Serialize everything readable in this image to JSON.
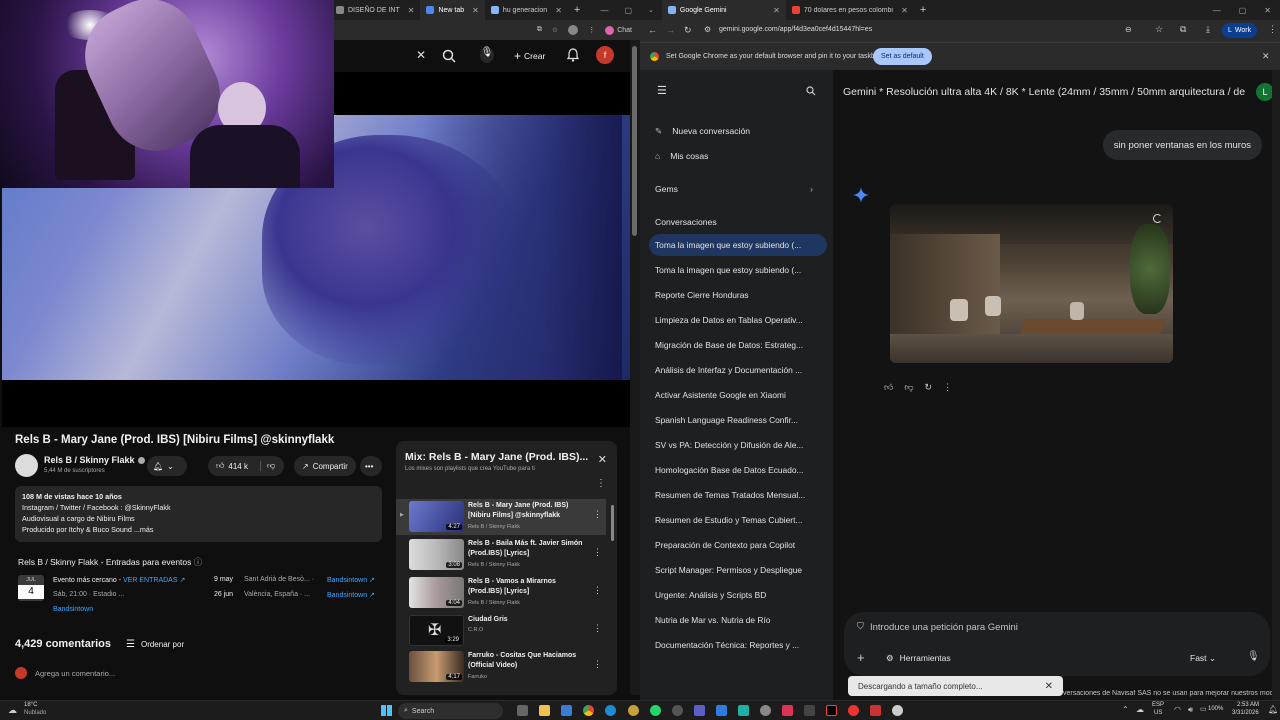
{
  "youtube": {
    "tabs": [
      {
        "label": "DISEÑO DE INT"
      },
      {
        "label": "New tab"
      },
      {
        "label": "hu generacion"
      }
    ],
    "header": {
      "create_label": "Crear",
      "avatar_letter": "f",
      "chat_label": "Chat"
    },
    "video_title": "Rels B - Mary Jane (Prod. IBS) [Nibiru Films] @skinnyflakk",
    "channel": {
      "name": "Rels B / Skinny Flakk",
      "subscribers": "5,44 M de suscriptores"
    },
    "likes": "414 k",
    "share_label": "Compartir",
    "description": {
      "meta": "108 M de vistas  hace 10 años",
      "lines": [
        "Instagram / Twitter / Facebook : @SkinnyFlakk",
        "Audiovisual a cargo de Nibiru Films",
        "Producido por Itchy & Buco Sound   ...más"
      ]
    },
    "events": {
      "title": "Rels B / Skinny Flakk - Entradas para eventos",
      "badge_month": "JUL",
      "badge_day": "4",
      "featured_title": "Evento más cercano -",
      "featured_link": "VER ENTRADAS",
      "featured_sub": "Sáb, 21:00 · Estadio ...",
      "featured_source": "Bandsintown",
      "list": [
        {
          "date": "9 may",
          "place": "Sant Adrià de Besò... ·",
          "source": "Bandsintown"
        },
        {
          "date": "26 jun",
          "place": "València, España · ...",
          "source": "Bandsintown"
        }
      ]
    },
    "comments_count": "4,429 comentarios",
    "sort_label": "Ordenar por",
    "add_comment_placeholder": "Agrega un comentario...",
    "mix": {
      "title": "Mix: Rels B - Mary Jane (Prod. IBS)...",
      "subtitle": "Los mixes son playlists que crea YouTube para ti",
      "items": [
        {
          "title": "Rels B - Mary Jane (Prod. IBS) [Nibiru Films] @skinnyflakk",
          "channel": "Rels B / Skinny Flakk",
          "duration": "4:27"
        },
        {
          "title": "Rels B - Baila Más ft. Javier Simón (Prod.IBS) [Lyrics]",
          "channel": "Rels B / Skinny Flakk",
          "duration": "3:08"
        },
        {
          "title": "Rels B - Vamos a Mirarnos (Prod.IBS) [Lyrics]",
          "channel": "Rels B / Skinny Flakk",
          "duration": "4:04"
        },
        {
          "title": "Ciudad Gris",
          "channel": "C.R.O",
          "duration": "3:29"
        },
        {
          "title": "Farruko - Cositas Que Haciamos (Official Video)",
          "channel": "Farruko",
          "duration": "4:17"
        }
      ]
    }
  },
  "gemini": {
    "tabs": [
      {
        "label": "Google Gemini"
      },
      {
        "label": "70 dolares en pesos colombian"
      }
    ],
    "url": "gemini.google.com/app/f4d3ea0cef4d15447hl=es",
    "profile_label": "Work",
    "infobar": {
      "text": "Set Google Chrome as your default browser and pin it to your taskbar",
      "button": "Set as default"
    },
    "sidebar": {
      "new_chat": "Nueva conversación",
      "my_stuff": "Mis cosas",
      "gems": "Gems",
      "conversations_header": "Conversaciones",
      "conversations": [
        "Toma la imagen que estoy subiendo (...",
        "Toma la imagen que estoy subiendo (...",
        "Reporte Cierre Honduras",
        "Limpieza de Datos en Tablas Operativ...",
        "Migración de Base de Datos: Estrateg...",
        "Análisis de Interfaz y Documentación ...",
        "Activar Asistente Google en Xiaomi",
        "Spanish Language Readiness Confir...",
        "SV vs PA: Detección y Difusión de Ale...",
        "Homologación Base de Datos Ecuado...",
        "Resumen de Temas Tratados Mensual...",
        "Resumen de Estudio y Temas Cubiert...",
        "Preparación de Contexto para Copilot",
        "Script Manager: Permisos y Despliegue",
        "Urgente: Análisis y Scripts BD",
        "Nutria de Mar vs. Nutria de Río",
        "Documentación Técnica: Reportes y ..."
      ]
    },
    "brand": "Gemini",
    "chat_title": "Gemini * Resolución ultra alta 4K / 8K * Lente (24mm / 35mm / 50mm arquitectura / de",
    "avatar_letter": "L",
    "user_message": "sin poner ventanas en los muros",
    "prompt_placeholder": "Introduce una petición para Gemini",
    "tools_label": "Herramientas",
    "model_label": "Fast",
    "download_toast": "Descargando a tamaño completo...",
    "disclaimer": "versaciones de Navisaf SAS no se usan para mejorar nuestros modelos. Gemini es una IA y puede cometer errores"
  },
  "taskbar": {
    "weather_temp": "18°C",
    "weather_desc": "Nublado",
    "search_placeholder": "Search",
    "lang": "ESP",
    "lang_sub": "US",
    "battery": "100%",
    "time": "2:53 AM",
    "date": "3/31/2026"
  }
}
